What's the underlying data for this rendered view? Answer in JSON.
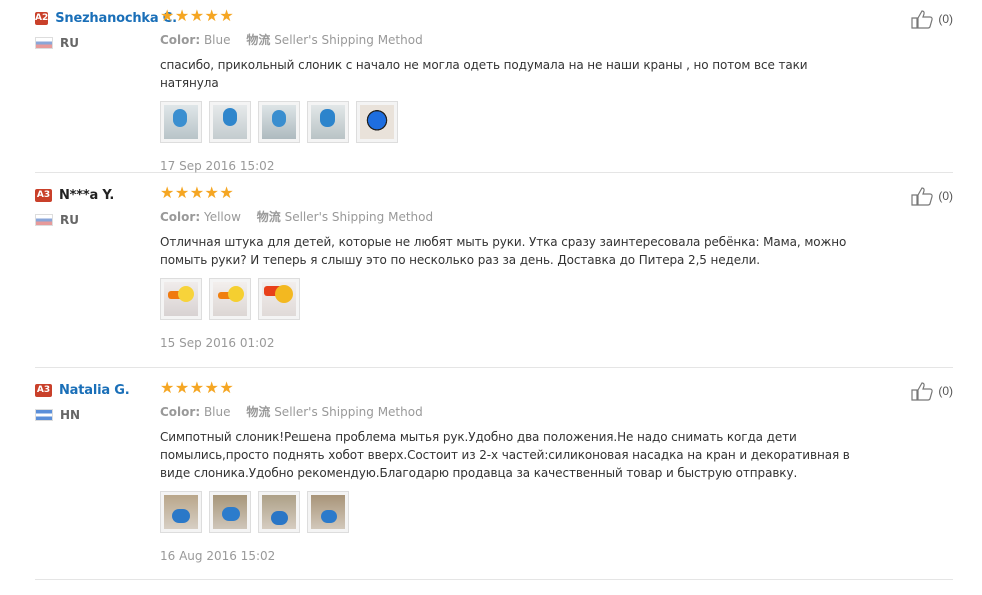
{
  "colors": {
    "star": "#f5a623",
    "level_badge": "#c9402a",
    "name_link": "#1a6fb8"
  },
  "icons": {
    "star": "star-icon",
    "thumb": "thumb-up-icon"
  },
  "reviews": [
    {
      "level": "A2",
      "name": "Snezhanochka C.",
      "country": "RU",
      "flag": "russia-flag-icon",
      "stars": "★★★★★",
      "rating": 5,
      "color_label": "Color:",
      "color_value": "Blue",
      "shipping_chinese": "物流",
      "shipping": "Seller's Shipping Method",
      "text": "спасибо, прикольный слоник с начало не могла одеть подумала на не наши краны , но потом все таки натянула",
      "images": [
        "photo-1",
        "photo-2",
        "photo-3",
        "photo-4",
        "photo-5"
      ],
      "date": "17 Sep 2016 15:02",
      "helpful": "(0)"
    },
    {
      "level": "A3",
      "name": "N***a Y.",
      "country": "RU",
      "flag": "russia-flag-icon",
      "stars": "★★★★★",
      "rating": 5,
      "color_label": "Color:",
      "color_value": "Yellow",
      "shipping_chinese": "物流",
      "shipping": "Seller's Shipping Method",
      "text": "Отличная штука для детей, которые не любят мыть руки. Утка сразу заинтересовала ребёнка: Мама, можно помыть руки? И теперь я слышу это по несколько раз за день. Доставка до Питера 2,5 недели.",
      "images": [
        "photo-1",
        "photo-2",
        "photo-3"
      ],
      "date": "15 Sep 2016 01:02",
      "helpful": "(0)"
    },
    {
      "level": "A3",
      "name": "Natalia G.",
      "country": "HN",
      "flag": "honduras-flag-icon",
      "stars": "★★★★★",
      "rating": 5,
      "color_label": "Color:",
      "color_value": "Blue",
      "shipping_chinese": "物流",
      "shipping": "Seller's Shipping Method",
      "text": "Симпотный слоник!Решена проблема мытья рук.Удобно два положения.Не надо снимать когда дети помылись,просто поднять хобот вверх.Состоит из 2-х частей:силиконовая насадка на кран и декоративная в виде слоника.Удобно рекомендую.Благодарю продавца за качественный товар и быструю отправку.",
      "images": [
        "photo-1",
        "photo-2",
        "photo-3",
        "photo-4"
      ],
      "date": "16 Aug 2016 15:02",
      "helpful": "(0)"
    }
  ]
}
